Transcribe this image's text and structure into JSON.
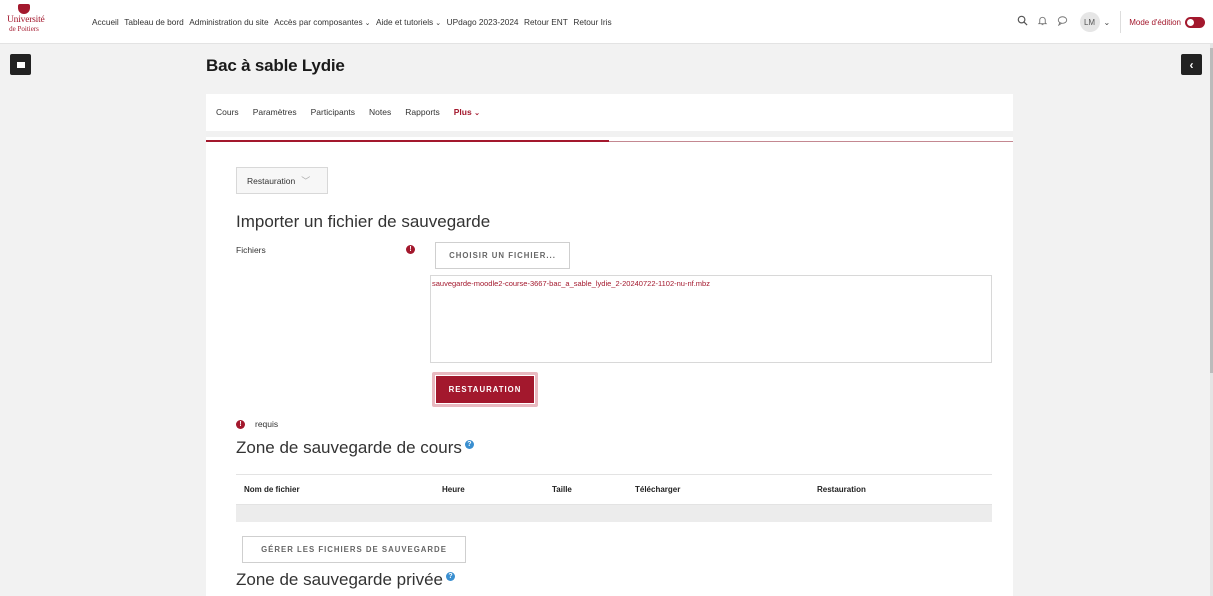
{
  "header": {
    "logo": {
      "line1": "Université",
      "line2": "de Poitiers"
    },
    "nav": [
      {
        "label": "Accueil",
        "dropdown": false
      },
      {
        "label": "Tableau de bord",
        "dropdown": false
      },
      {
        "label": "Administration du site",
        "dropdown": false
      },
      {
        "label": "Accès par composantes",
        "dropdown": true
      },
      {
        "label": "Aide et tutoriels",
        "dropdown": true
      },
      {
        "label": "UPdago 2023-2024",
        "dropdown": false
      },
      {
        "label": "Retour ENT",
        "dropdown": false
      },
      {
        "label": "Retour Iris",
        "dropdown": false
      }
    ],
    "user_initials": "LM",
    "edit_mode_label": "Mode d'édition",
    "edit_mode_on": true
  },
  "page": {
    "title": "Bac à sable Lydie"
  },
  "tabs": [
    {
      "label": "Cours",
      "active": false
    },
    {
      "label": "Paramètres",
      "active": false
    },
    {
      "label": "Participants",
      "active": false
    },
    {
      "label": "Notes",
      "active": false
    },
    {
      "label": "Rapports",
      "active": false
    },
    {
      "label": "Plus",
      "active": true
    }
  ],
  "main": {
    "select_label": "Restauration",
    "import_heading": "Importer un fichier de sauvegarde",
    "files_label": "Fichiers",
    "choose_file_button": "CHOISIR UN FICHIER...",
    "selected_file": "sauvegarde-moodle2-course-3667-bac_a_sable_lydie_2-20240722-1102-nu-nf.mbz",
    "restore_button": "RESTAURATION",
    "required_note": "requis",
    "course_backup_heading": "Zone de sauvegarde de cours",
    "table_headers": [
      "Nom de fichier",
      "Heure",
      "Taille",
      "Télécharger",
      "Restauration"
    ],
    "manage_button": "GÉRER LES FICHIERS DE SAUVEGARDE",
    "private_backup_heading": "Zone de sauvegarde privée"
  },
  "colors": {
    "accent": "#a3182d",
    "help": "#3a8fd0"
  }
}
